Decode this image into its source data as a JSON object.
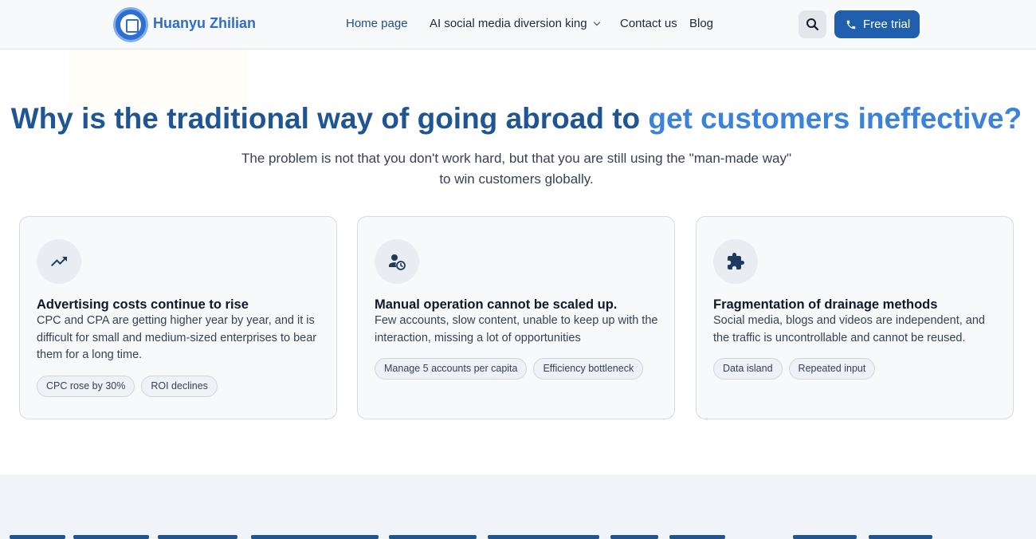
{
  "header": {
    "brand": "Huanyu Zhilian",
    "nav": {
      "home": "Home page",
      "ai_menu": "AI social media diversion king",
      "contact": "Contact us",
      "blog": "Blog"
    },
    "cta": "Free trial"
  },
  "hero": {
    "title_part1": "Why is the traditional way of going abroad to ",
    "title_part2": "get customers ineffective?",
    "subtitle_line1": "The problem is not that you don't work hard, but that you are still using the \"man-made way\"",
    "subtitle_line2": "to win customers globally."
  },
  "cards": [
    {
      "icon": "trending-up-icon",
      "title": "Advertising costs continue to rise",
      "text": "CPC and CPA are getting higher year by year, and it is difficult for small and medium-sized enterprises to bear them for a long time.",
      "tags": [
        "CPC rose by 30%",
        "ROI declines"
      ]
    },
    {
      "icon": "user-clock-icon",
      "title": "Manual operation cannot be scaled up.",
      "text": "Few accounts, slow content, unable to keep up with the interaction, missing a lot of opportunities",
      "tags": [
        "Manage 5 accounts per capita",
        "Efficiency bottleneck"
      ]
    },
    {
      "icon": "puzzle-icon",
      "title": "Fragmentation of drainage methods",
      "text": "Social media, blogs and videos are independent, and the traffic is uncontrollable and cannot be reused.",
      "tags": [
        "Data island",
        "Repeated input"
      ]
    }
  ],
  "colors": {
    "brand_blue": "#1f5fae",
    "title_dark": "#1e5592",
    "title_light": "#3b82db"
  }
}
